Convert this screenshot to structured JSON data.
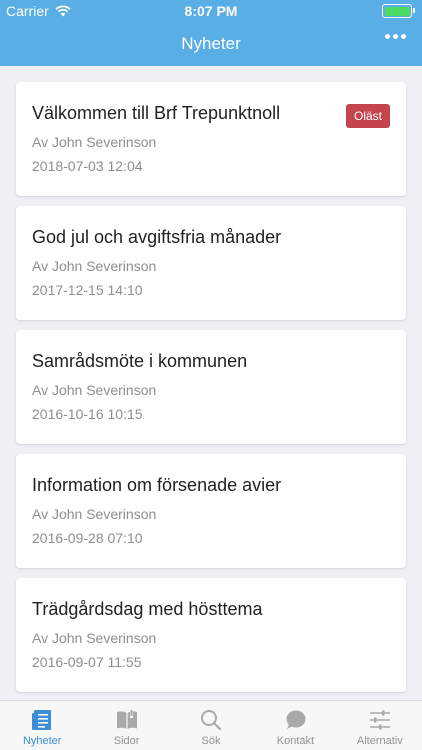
{
  "status": {
    "carrier": "Carrier",
    "time": "8:07 PM"
  },
  "header": {
    "title": "Nyheter"
  },
  "news": [
    {
      "title": "Välkommen till Brf Trepunktnoll",
      "author": "Av John Severinson",
      "date": "2018-07-03 12:04",
      "badge": "Oläst"
    },
    {
      "title": "God jul och avgiftsfria månader",
      "author": "Av John Severinson",
      "date": "2017-12-15 14:10"
    },
    {
      "title": "Samrådsmöte i kommunen",
      "author": "Av John Severinson",
      "date": "2016-10-16 10:15"
    },
    {
      "title": "Information om försenade avier",
      "author": "Av John Severinson",
      "date": "2016-09-28 07:10"
    },
    {
      "title": "Trädgårdsdag med hösttema",
      "author": "Av John Severinson",
      "date": "2016-09-07 11:55"
    }
  ],
  "tabs": [
    {
      "label": "Nyheter",
      "icon": "news-icon",
      "active": true
    },
    {
      "label": "Sidor",
      "icon": "book-icon"
    },
    {
      "label": "Sök",
      "icon": "search-icon"
    },
    {
      "label": "Kontakt",
      "icon": "chat-icon"
    },
    {
      "label": "Alternativ",
      "icon": "sliders-icon"
    }
  ],
  "colors": {
    "header": "#5aaee6",
    "accent": "#3b8fd9",
    "badge": "#c5454d",
    "background": "#efeff4"
  }
}
